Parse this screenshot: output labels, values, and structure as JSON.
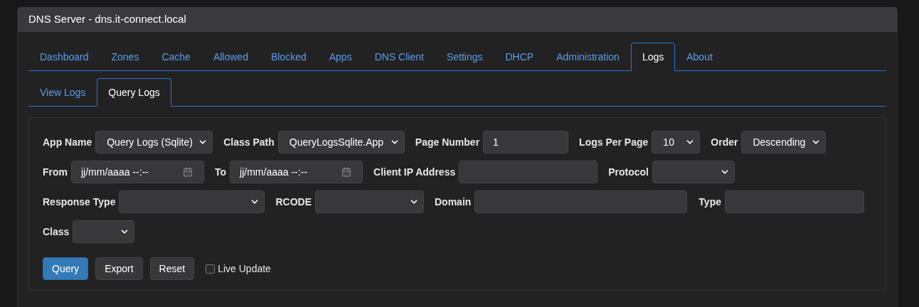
{
  "window": {
    "title": "DNS Server - dns.it-connect.local"
  },
  "tabs": [
    {
      "label": "Dashboard",
      "selected": false
    },
    {
      "label": "Zones",
      "selected": false
    },
    {
      "label": "Cache",
      "selected": false
    },
    {
      "label": "Allowed",
      "selected": false
    },
    {
      "label": "Blocked",
      "selected": false
    },
    {
      "label": "Apps",
      "selected": false
    },
    {
      "label": "DNS Client",
      "selected": false
    },
    {
      "label": "Settings",
      "selected": false
    },
    {
      "label": "DHCP",
      "selected": false
    },
    {
      "label": "Administration",
      "selected": false
    },
    {
      "label": "Logs",
      "selected": true
    },
    {
      "label": "About",
      "selected": false
    }
  ],
  "subtabs": [
    {
      "label": "View Logs",
      "selected": false
    },
    {
      "label": "Query Logs",
      "selected": true
    }
  ],
  "form": {
    "rows": [
      [
        {
          "label": "App Name",
          "kind": "select",
          "value": "Query Logs (Sqlite)"
        },
        {
          "label": "Class Path",
          "kind": "select",
          "value": "QueryLogsSqlite.App"
        },
        {
          "label": "Page Number",
          "kind": "input",
          "value": "1"
        },
        {
          "label": "Logs Per Page",
          "kind": "select",
          "value": "10"
        },
        {
          "label": "Order",
          "kind": "select",
          "value": "Descending"
        }
      ],
      [
        {
          "label": "From",
          "kind": "datetime",
          "placeholder": "jj/mm/aaaa --:--"
        },
        {
          "label": "To",
          "kind": "datetime",
          "placeholder": "jj/mm/aaaa --:--"
        },
        {
          "label": "Client IP Address",
          "kind": "input"
        },
        {
          "label": "Protocol",
          "kind": "select"
        }
      ],
      [
        {
          "label": "Response Type",
          "kind": "select"
        },
        {
          "label": "RCODE",
          "kind": "select"
        },
        {
          "label": "Domain",
          "kind": "input"
        },
        {
          "label": "Type",
          "kind": "input"
        }
      ],
      [
        {
          "label": "Class",
          "kind": "select"
        }
      ]
    ],
    "buttons": [
      {
        "label": "Query",
        "kind": "primary"
      },
      {
        "label": "Export",
        "kind": "default"
      },
      {
        "label": "Reset",
        "kind": "default"
      }
    ],
    "live_update": {
      "label": "Live Update",
      "checked": false
    }
  }
}
